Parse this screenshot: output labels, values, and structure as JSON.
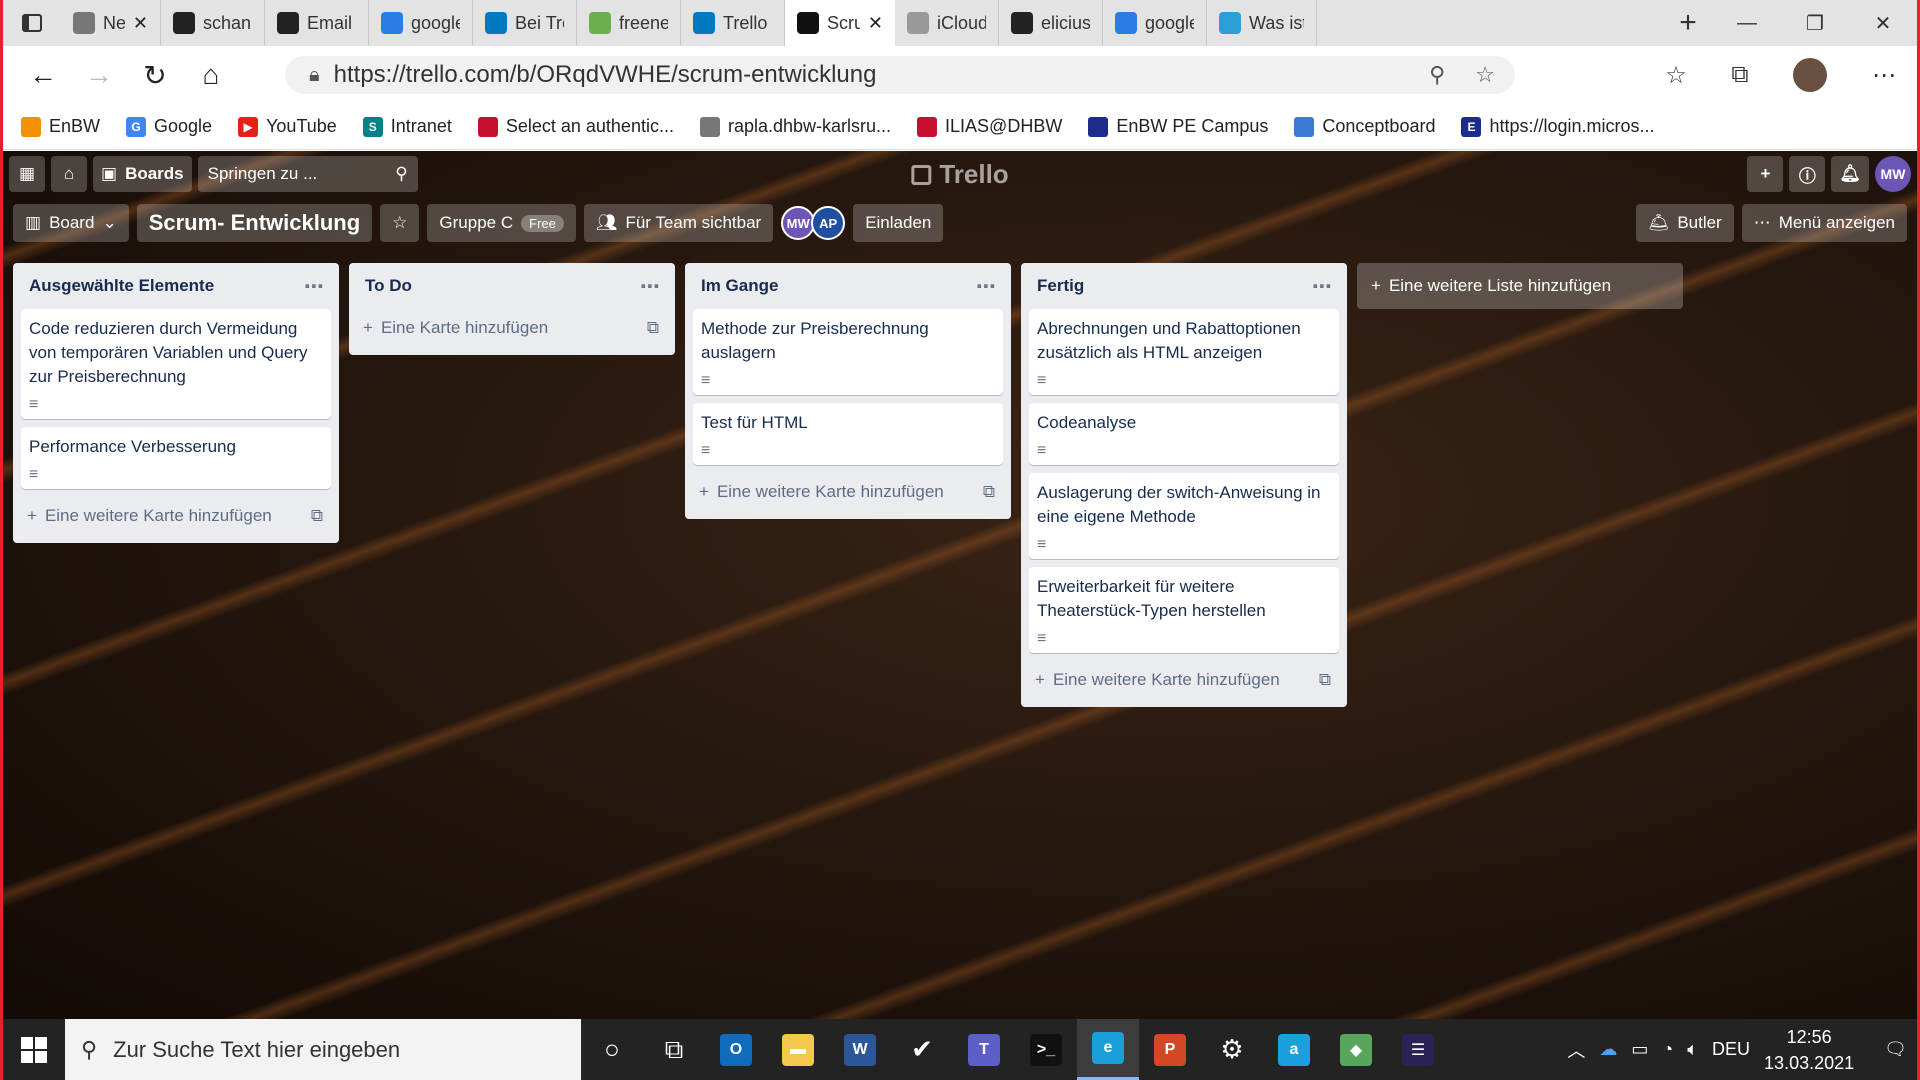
{
  "browser": {
    "tabs": [
      {
        "label": "Neu",
        "icon": "new-tab-icon",
        "color": "#777"
      },
      {
        "label": "schanne",
        "icon": "github-icon",
        "color": "#222"
      },
      {
        "label": "Email se",
        "icon": "github-icon",
        "color": "#222"
      },
      {
        "label": "google",
        "icon": "bing-icon",
        "color": "#2a7de1"
      },
      {
        "label": "Bei Trello",
        "icon": "trello-icon",
        "color": "#0079bf"
      },
      {
        "label": "freenet M",
        "icon": "freenet-icon",
        "color": "#6ab04c"
      },
      {
        "label": "Trello",
        "icon": "trello-icon",
        "color": "#0079bf"
      },
      {
        "label": "Scru",
        "icon": "trello-icon",
        "color": "#111"
      },
      {
        "label": "iCloud",
        "icon": "apple-icon",
        "color": "#999"
      },
      {
        "label": "elicius-a",
        "icon": "github-icon",
        "color": "#222"
      },
      {
        "label": "google",
        "icon": "bing-icon",
        "color": "#2a7de1"
      },
      {
        "label": "Was ist d",
        "icon": "browser-icon",
        "color": "#2a9fd6"
      }
    ],
    "url": "https://trello.com/b/ORqdVWHE/scrum-entwicklung",
    "bookmarks": [
      {
        "label": "EnBW",
        "icon": "enbw-icon",
        "color": "#f39200"
      },
      {
        "label": "Google",
        "icon": "google-icon",
        "color": "#4285f4",
        "glyph": "G"
      },
      {
        "label": "YouTube",
        "icon": "youtube-icon",
        "color": "#e62117",
        "glyph": "▶"
      },
      {
        "label": "Intranet",
        "icon": "sharepoint-icon",
        "color": "#038387",
        "glyph": "S"
      },
      {
        "label": "Select an authentic...",
        "icon": "dhbw-icon",
        "color": "#c8102e"
      },
      {
        "label": "rapla.dhbw-karlsru...",
        "icon": "rapla-icon",
        "color": "#777"
      },
      {
        "label": "ILIAS@DHBW",
        "icon": "dhbw-icon",
        "color": "#c8102e"
      },
      {
        "label": "EnBW PE Campus",
        "icon": "enbw-icon",
        "color": "#1d2c8a"
      },
      {
        "label": "Conceptboard",
        "icon": "conceptboard-icon",
        "color": "#3b7bd4"
      },
      {
        "label": "https://login.micros...",
        "icon": "login-icon",
        "color": "#1d2c8a",
        "glyph": "E"
      }
    ]
  },
  "trello": {
    "header": {
      "boards_label": "Boards",
      "search_placeholder": "Springen zu ...",
      "logo": "Trello",
      "user_initials": "MW"
    },
    "board": {
      "view_label": "Board",
      "title": "Scrum- Entwicklung",
      "team_label": "Gruppe C",
      "team_badge": "Free",
      "visibility_label": "Für Team sichtbar",
      "members": [
        {
          "initials": "MW",
          "color": "#6b55b5"
        },
        {
          "initials": "AP",
          "color": "#1f4fa0"
        }
      ],
      "invite_label": "Einladen",
      "butler_label": "Butler",
      "menu_label": "Menü anzeigen",
      "add_list_label": "Eine weitere Liste hinzufügen"
    },
    "lists": [
      {
        "title": "Ausgewählte Elemente",
        "cards": [
          "Code reduzieren durch Vermeidung von temporären Variablen und Query zur Preisberechnung",
          "Performance Verbesserung"
        ],
        "add_label": "Eine weitere Karte hinzufügen"
      },
      {
        "title": "To Do",
        "cards": [],
        "add_label": "Eine Karte hinzufügen"
      },
      {
        "title": "Im Gange",
        "cards": [
          "Methode zur Preisberechnung auslagern",
          "Test für HTML"
        ],
        "add_label": "Eine weitere Karte hinzufügen"
      },
      {
        "title": "Fertig",
        "cards": [
          "Abrechnungen und Rabattoptionen zusätzlich als HTML anzeigen",
          "Codeanalyse",
          "Auslagerung der switch-Anweisung in eine eigene Methode",
          "Erweiterbarkeit für weitere Theaterstück-Typen herstellen"
        ],
        "add_label": "Eine weitere Karte hinzufügen"
      }
    ]
  },
  "taskbar": {
    "search_placeholder": "Zur Suche Text hier eingeben",
    "apps": [
      {
        "name": "cortana-icon",
        "glyph": "○",
        "color": ""
      },
      {
        "name": "task-view-icon",
        "glyph": "⧉",
        "color": ""
      },
      {
        "name": "outlook-icon",
        "glyph": "O",
        "color": "#0f6cbd"
      },
      {
        "name": "file-explorer-icon",
        "glyph": "▬",
        "color": "#f2c94c"
      },
      {
        "name": "word-icon",
        "glyph": "W",
        "color": "#2b579a"
      },
      {
        "name": "todo-icon",
        "glyph": "✔",
        "color": ""
      },
      {
        "name": "teams-icon",
        "glyph": "T",
        "color": "#5b5fc7"
      },
      {
        "name": "terminal-icon",
        "glyph": ">_",
        "color": "#111"
      },
      {
        "name": "edge-icon",
        "glyph": "e",
        "color": "#1a9fd9"
      },
      {
        "name": "powerpoint-icon",
        "glyph": "P",
        "color": "#d24726"
      },
      {
        "name": "settings-icon",
        "glyph": "⚙",
        "color": ""
      },
      {
        "name": "ausweis-app-icon",
        "glyph": "a",
        "color": "#1aa0dc"
      },
      {
        "name": "git-icon",
        "glyph": "◆",
        "color": "#58a55c"
      },
      {
        "name": "eclipse-icon",
        "glyph": "☰",
        "color": "#2c2255"
      }
    ],
    "language": "DEU",
    "time": "12:56",
    "date": "13.03.2021"
  }
}
